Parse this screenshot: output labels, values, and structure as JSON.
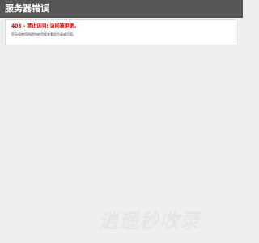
{
  "header": {
    "title": "服务器错误"
  },
  "error": {
    "heading": "403 - 禁止访问: 访问被拒绝。",
    "detail": "您无权使用所提供的凭据查看此目录或页面。"
  },
  "watermark": {
    "text": "逍遥秒收录"
  },
  "colors": {
    "header_background": "#555555",
    "header_text": "#ffffff",
    "page_background": "#efefef",
    "error_heading": "#cc0000",
    "detail_text": "#333333",
    "watermark": "#e5e5e5"
  }
}
